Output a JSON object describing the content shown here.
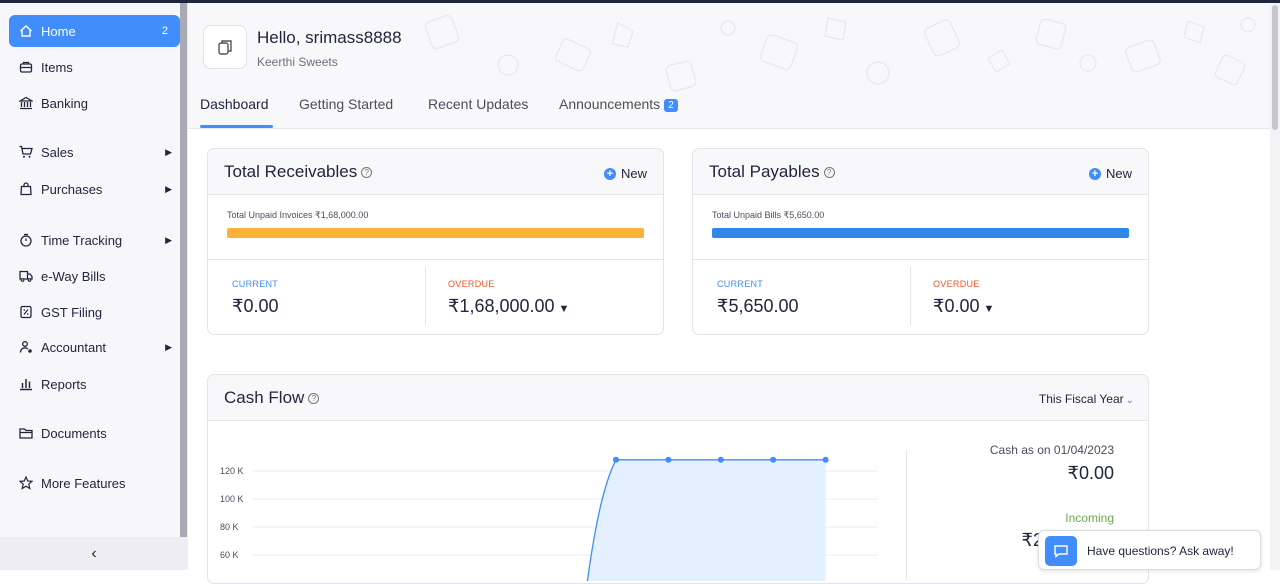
{
  "sidebar": {
    "items": [
      {
        "label": "Home",
        "badge": "2",
        "icon": "home-icon"
      },
      {
        "label": "Items",
        "icon": "items-icon"
      },
      {
        "label": "Banking",
        "icon": "bank-icon"
      },
      {
        "label": "Sales",
        "icon": "cart-icon"
      },
      {
        "label": "Purchases",
        "icon": "bag-icon"
      },
      {
        "label": "Time Tracking",
        "icon": "stopwatch-icon"
      },
      {
        "label": "e-Way Bills",
        "icon": "truck-icon"
      },
      {
        "label": "GST Filing",
        "icon": "tax-document-icon"
      },
      {
        "label": "Accountant",
        "icon": "accountant-icon"
      },
      {
        "label": "Reports",
        "icon": "bar-chart-icon"
      },
      {
        "label": "Documents",
        "icon": "folder-icon"
      },
      {
        "label": "More Features",
        "icon": "star-icon"
      }
    ],
    "collapse_icon": "‹"
  },
  "header": {
    "greeting": "Hello, srimass8888",
    "org_name": "Keerthi Sweets",
    "tabs": [
      {
        "label": "Dashboard"
      },
      {
        "label": "Getting Started"
      },
      {
        "label": "Recent Updates"
      },
      {
        "label": "Announcements",
        "badge": "2"
      }
    ]
  },
  "receivables": {
    "title": "Total Receivables",
    "new_label": "New",
    "unpaid_label": "Total Unpaid Invoices ₹1,68,000.00",
    "bar_color": "#fbb23b",
    "current_label": "CURRENT",
    "current_value": "₹0.00",
    "overdue_label": "OVERDUE",
    "overdue_value": "₹1,68,000.00"
  },
  "payables": {
    "title": "Total Payables",
    "new_label": "New",
    "unpaid_label": "Total Unpaid Bills ₹5,650.00",
    "bar_color": "#2f86eb",
    "current_label": "CURRENT",
    "current_value": "₹5,650.00",
    "overdue_label": "OVERDUE",
    "overdue_value": "₹0.00"
  },
  "cash_flow": {
    "title": "Cash Flow",
    "period": "This Fiscal Year",
    "cash_as_on": "Cash as on 01/04/2023",
    "cash_value": "₹0.00",
    "incoming_label": "Incoming",
    "incoming_value_partial": "₹2,0"
  },
  "chart_data": {
    "type": "area",
    "ytick_labels": [
      "120 K",
      "100 K",
      "80 K",
      "60 K"
    ],
    "yticks": [
      120000,
      100000,
      80000,
      60000
    ],
    "x": [
      1,
      2,
      3,
      4,
      5,
      6,
      7,
      8,
      9,
      10,
      11,
      12
    ],
    "values": [
      0,
      0,
      0,
      0,
      0,
      0,
      0,
      128000,
      128000,
      128000,
      128000,
      128000
    ],
    "ylim": [
      0,
      140000
    ],
    "color": "#408dfb"
  },
  "help_widget": {
    "label": "Have questions? Ask away!"
  }
}
